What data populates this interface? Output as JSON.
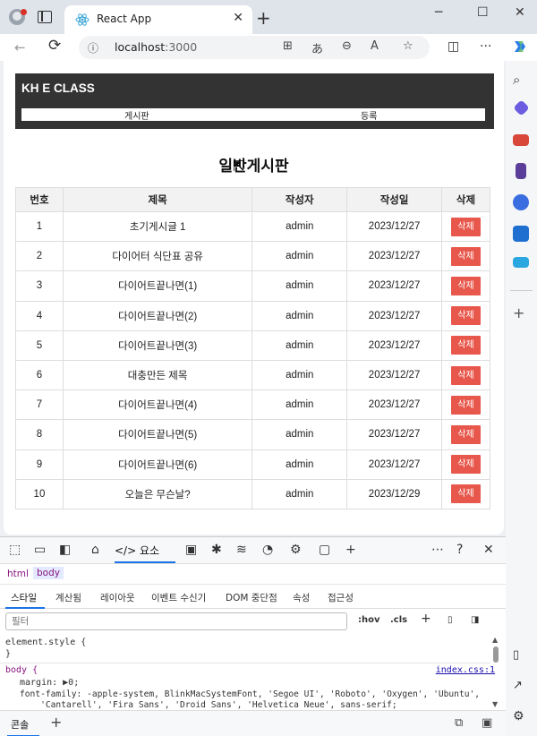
{
  "browser": {
    "tab_title": "React App",
    "tab_close": "✕",
    "new_tab": "+",
    "minimize": "─",
    "maximize": "☐",
    "close": "✕",
    "back": "←",
    "reload": "⟳",
    "lock": "ⓘ",
    "url_host": "localhost",
    "url_port": ":3000",
    "more": "···"
  },
  "site": {
    "title": "KH E CLASS",
    "nav": [
      "게시판",
      "등록"
    ]
  },
  "board": {
    "heading": "일반게시판",
    "columns": [
      "번호",
      "제목",
      "작성자",
      "작성일",
      "삭제"
    ],
    "delete_label": "삭제",
    "rows": [
      {
        "no": "1",
        "title": "초기게시글 1",
        "author": "admin",
        "date": "2023/12/27"
      },
      {
        "no": "2",
        "title": "다이어터 식단표 공유",
        "author": "admin",
        "date": "2023/12/27"
      },
      {
        "no": "3",
        "title": "다이어트끝나면(1)",
        "author": "admin",
        "date": "2023/12/27"
      },
      {
        "no": "4",
        "title": "다이어트끝나면(2)",
        "author": "admin",
        "date": "2023/12/27"
      },
      {
        "no": "5",
        "title": "다이어트끝나면(3)",
        "author": "admin",
        "date": "2023/12/27"
      },
      {
        "no": "6",
        "title": "대충만든 제목",
        "author": "admin",
        "date": "2023/12/27"
      },
      {
        "no": "7",
        "title": "다이어트끝나면(4)",
        "author": "admin",
        "date": "2023/12/27"
      },
      {
        "no": "8",
        "title": "다이어트끝나면(5)",
        "author": "admin",
        "date": "2023/12/27"
      },
      {
        "no": "9",
        "title": "다이어트끝나면(6)",
        "author": "admin",
        "date": "2023/12/27"
      },
      {
        "no": "10",
        "title": "오늘은 무슨날?",
        "author": "admin",
        "date": "2023/12/29"
      }
    ]
  },
  "devtools": {
    "active_tab": "</> 요소",
    "crumbs": [
      "html",
      "body"
    ],
    "subtabs": [
      "스타일",
      "계산됨",
      "레이아웃",
      "이벤트 수신기",
      "DOM 중단점",
      "속성",
      "접근성"
    ],
    "filter_placeholder": "필터",
    "filter_hov": ":hov",
    "filter_cls": ".cls",
    "element_style": "element.style {",
    "close_brace": "}",
    "body_selector": "body {",
    "source_link": "index.css:1",
    "margin_line": "margin: ▶0;",
    "font_family_line": "font-family: -apple-system, BlinkMacSystemFont, 'Segoe UI', 'Roboto', 'Oxygen', 'Ubuntu',",
    "font_family_cont": "    'Cantarell', 'Fira Sans', 'Droid Sans', 'Helvetica Neue', sans-serif;",
    "console_tab": "콘솔",
    "add_tab": "+"
  },
  "colors": {
    "header_bg": "#333333",
    "delete_button": "#e8574b",
    "accent": "#1a73e8"
  }
}
